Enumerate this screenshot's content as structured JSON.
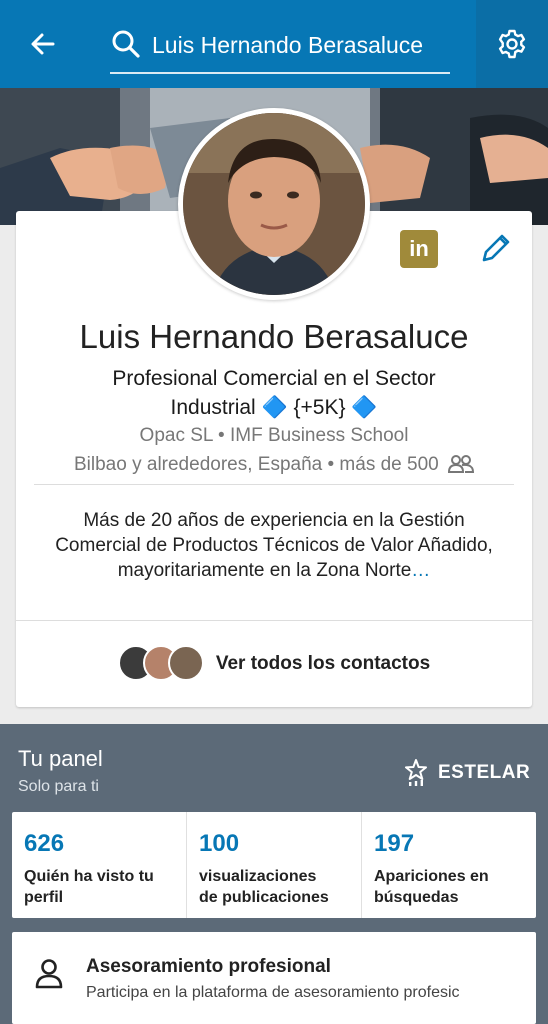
{
  "header": {
    "search_value": "Luis Hernando Berasaluce",
    "back_icon": "back-arrow-icon",
    "search_icon": "search-icon",
    "settings_icon": "gear-icon",
    "bar_color": "#0777b5"
  },
  "profile": {
    "name": "Luis Hernando Berasaluce",
    "headline_line1": "Profesional Comercial en el Sector",
    "headline_line2": "Industrial 🔷 {+5K} 🔷",
    "company": "Opac SL • IMF Business School",
    "location": "Bilbao y alrededores, España • más de 500",
    "badge": "in",
    "summary": "Más de 20 años de experiencia en la Gestión Comercial de Productos Técnicos de Valor Añadido, mayoritariamente en la Zona Norte",
    "summary_more": "…",
    "contacts_label": "Ver todos los contactos"
  },
  "dashboard": {
    "title": "Tu panel",
    "subtitle": "Solo para ti",
    "estelar_label": "ESTELAR",
    "stats": [
      {
        "value": "626",
        "label_line1": "Quién ha visto tu",
        "label_line2": "perfil"
      },
      {
        "value": "100",
        "label_line1": "visualizaciones",
        "label_line2": "de publicaciones"
      },
      {
        "value": "197",
        "label_line1": "Apariciones en",
        "label_line2": "búsquedas"
      }
    ],
    "advice": {
      "title": "Asesoramiento profesional",
      "subtitle": "Participa en la plataforma de asesoramiento profesic"
    }
  }
}
